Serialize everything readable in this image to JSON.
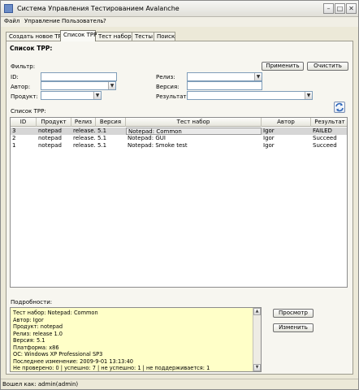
{
  "window": {
    "title": "Система Управления Тестированием Avalanche",
    "minimize": "–",
    "maximize": "□",
    "close": "✕"
  },
  "menu": [
    "Файл",
    "Управление",
    "Пользователь",
    "?"
  ],
  "tabs": [
    "Создать новое TPP",
    "Список TPP",
    "Тест наборы",
    "Тесты",
    "Поиск"
  ],
  "page": {
    "title": "Список TPP:",
    "filter_label": "Фильтр:",
    "apply": "Применить",
    "clear": "Очистить",
    "fields": {
      "id": "ID:",
      "author": "Автор:",
      "product": "Продукт:",
      "release": "Релиз:",
      "version": "Версия:",
      "result": "Результат:"
    },
    "list_label": "Список TPP:"
  },
  "table": {
    "columns": [
      "ID",
      "Продукт",
      "Релиз",
      "Версия",
      "Тест набор",
      "Автор",
      "Результат"
    ],
    "rows": [
      {
        "id": "3",
        "product": "notepad",
        "release": "release...",
        "version": "5.1",
        "set": "Notepad: Common",
        "author": "Igor",
        "result": "FAILED"
      },
      {
        "id": "2",
        "product": "notepad",
        "release": "release...",
        "version": "5.1",
        "set": "Notepad: GUI",
        "author": "Igor",
        "result": "Succeed"
      },
      {
        "id": "1",
        "product": "notepad",
        "release": "release...",
        "version": "5.1",
        "set": "Notepad: Smoke test",
        "author": "Igor",
        "result": "Succeed"
      }
    ]
  },
  "details": {
    "label": "Подробности:",
    "lines": [
      "Тест набор: Notepad: Common",
      "Автор: Igor",
      "Продукт: notepad",
      "Релиз: release 1.0",
      "Версия: 5.1",
      "Платформа: x86",
      "ОС: Windows XP Professional SP3",
      "Последнее изменение: 2009-9-01 13:13:40",
      "Не проверено: 0 | успешно: 7 | не успешно: 1 | не поддерживается: 1"
    ],
    "view": "Просмотр",
    "edit": "Изменить"
  },
  "status": "Вошел как: admin(admin)"
}
